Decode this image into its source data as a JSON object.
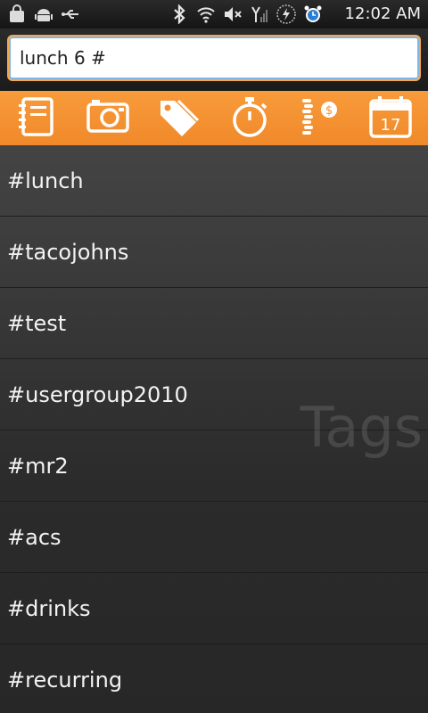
{
  "status_bar": {
    "time": "12:02 AM",
    "icons": [
      "shopping-bag-icon",
      "android-icon",
      "usb-icon",
      "bluetooth-icon",
      "wifi-icon",
      "mute-icon",
      "signal-icon",
      "battery-charging-icon",
      "alarm-icon"
    ]
  },
  "search": {
    "value": "lunch 6 #"
  },
  "toolbar": {
    "buttons": [
      "notebook-icon",
      "camera-icon",
      "tag-icon",
      "stopwatch-icon",
      "money-icon",
      "calendar-icon"
    ],
    "calendar_day": "17",
    "accent": "#f5922f"
  },
  "tags": {
    "watermark": "Tags",
    "items": [
      {
        "label": "#lunch"
      },
      {
        "label": "#tacojohns"
      },
      {
        "label": "#test"
      },
      {
        "label": "#usergroup2010"
      },
      {
        "label": "#mr2"
      },
      {
        "label": "#acs"
      },
      {
        "label": "#drinks"
      },
      {
        "label": "#recurring"
      }
    ]
  }
}
